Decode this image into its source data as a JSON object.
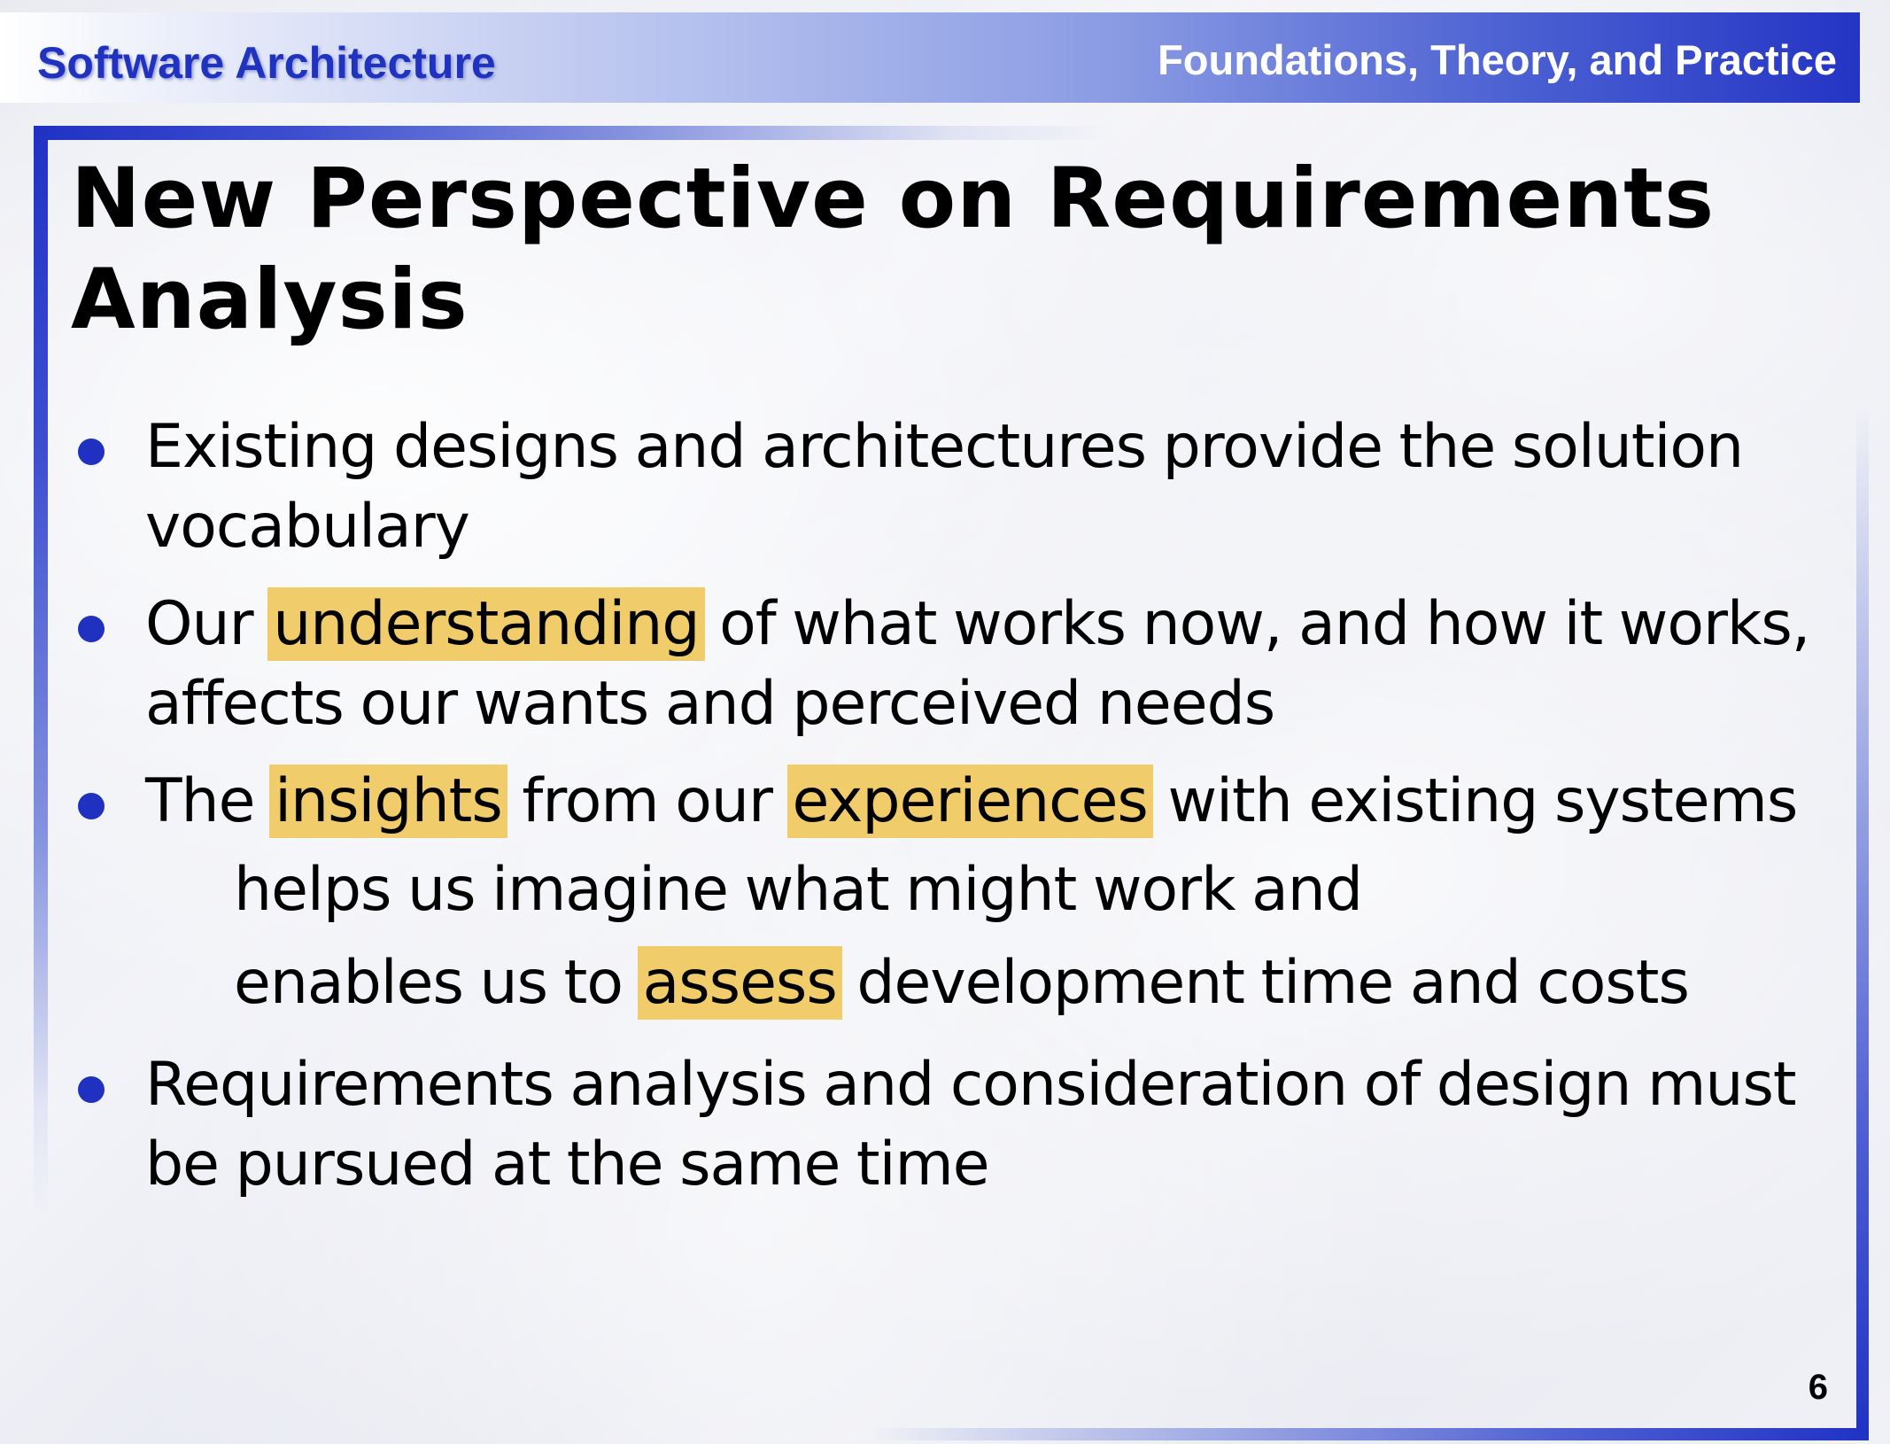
{
  "header": {
    "left": "Software Architecture",
    "right": "Foundations, Theory, and Practice"
  },
  "title": {
    "line1": "New Perspective on Requirements",
    "line2": "Analysis"
  },
  "bullets": {
    "b1": {
      "text": "Existing designs and architectures provide the solution vocabulary"
    },
    "b2": {
      "pre": "Our ",
      "hl1": "understanding",
      "post": " of what works now, and how it works, affects our wants and perceived needs"
    },
    "b3": {
      "pre": "The ",
      "hl1": "insights",
      "mid": " from our ",
      "hl2": "experiences",
      "post": " with existing systems",
      "sub1": "helps us imagine what might work and",
      "sub2_pre": "enables us to ",
      "sub2_hl": "assess",
      "sub2_post": " development time and costs"
    },
    "b4": {
      "text": "Requirements analysis and consideration of design must be pursued at the same time"
    }
  },
  "page_number": "6",
  "colors": {
    "accent_blue": "#2032c4",
    "highlight": "#f0cc6a",
    "bullet": "#2030c0"
  }
}
